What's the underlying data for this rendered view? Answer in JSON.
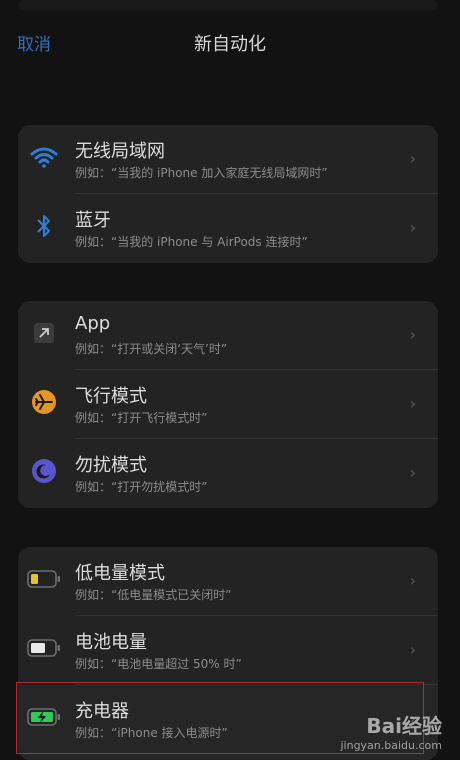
{
  "header": {
    "cancel_label": "取消",
    "title": "新自动化"
  },
  "sections": [
    {
      "items": [
        {
          "label": "无线局域网",
          "sub": "例如：“当我的 iPhone 加入家庭无线局域网时”",
          "icon": "wifi-icon"
        },
        {
          "label": "蓝牙",
          "sub": "例如：“当我的 iPhone 与 AirPods 连接时”",
          "icon": "bluetooth-icon"
        }
      ]
    },
    {
      "items": [
        {
          "label": "App",
          "sub": "例如：“打开或关闭‘天气’时”",
          "icon": "app-arrow-icon"
        },
        {
          "label": "飞行模式",
          "sub": "例如：“打开飞行模式时”",
          "icon": "airplane-icon"
        },
        {
          "label": "勿扰模式",
          "sub": "例如：“打开勿扰模式时”",
          "icon": "moon-icon"
        }
      ]
    },
    {
      "items": [
        {
          "label": "低电量模式",
          "sub": "例如：“低电量模式已关闭时”",
          "icon": "battery-low-icon"
        },
        {
          "label": "电池电量",
          "sub": "例如：“电池电量超过 50% 时”",
          "icon": "battery-level-icon"
        },
        {
          "label": "充电器",
          "sub": "例如：“iPhone 接入电源时”",
          "icon": "battery-charging-icon"
        }
      ]
    }
  ],
  "colors": {
    "accent": "#2f6fbd",
    "wifi": "#2d7fd6",
    "airplane": "#e4952b",
    "moon": "#5a55c8",
    "battery_low": "#e3c432",
    "battery_charging": "#34c759",
    "highlight_border": "#b52a2a"
  },
  "watermark": {
    "brand": "Bai经验",
    "url": "jingyan.baidu.com"
  }
}
